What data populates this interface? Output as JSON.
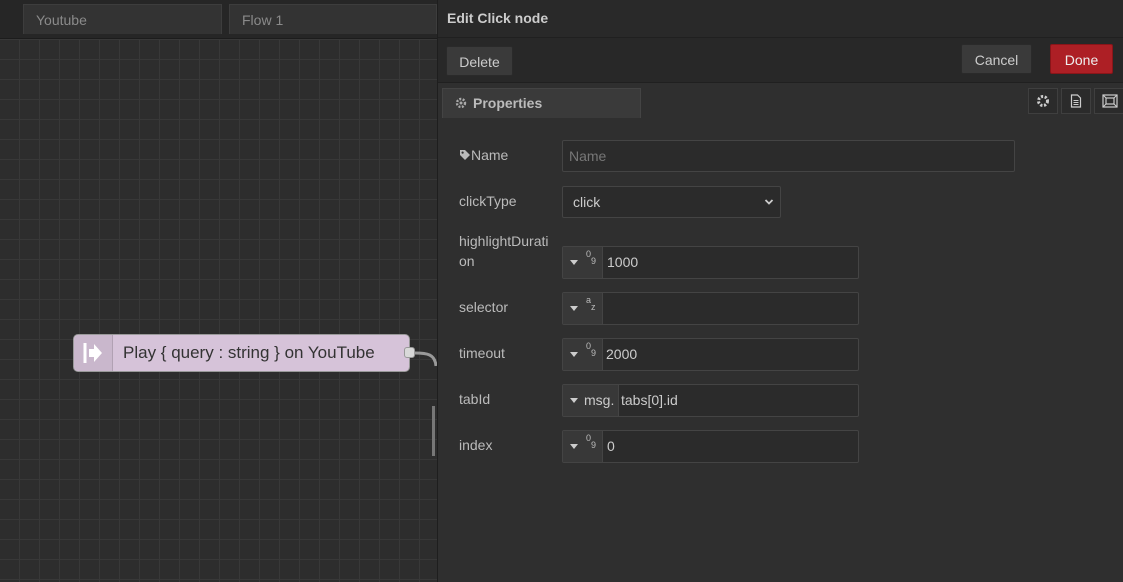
{
  "workspace": {
    "tabs": [
      "Youtube",
      "Flow 1"
    ],
    "node": {
      "label": "Play { query : string } on YouTube",
      "color": "#d6c3d9"
    }
  },
  "tray": {
    "title": "Edit Click node",
    "delete_label": "Delete",
    "cancel_label": "Cancel",
    "done_label": "Done",
    "properties_tab": "Properties",
    "side_icons": [
      "gear-icon",
      "document-icon",
      "frame-icon"
    ]
  },
  "form": {
    "name": {
      "label": "Name",
      "placeholder": "Name",
      "value": ""
    },
    "clickType": {
      "label": "clickType",
      "value": "click"
    },
    "highlightDuration": {
      "label_line1": "highlightDurati",
      "label_line2": "on",
      "type": "num",
      "value": "1000"
    },
    "selector": {
      "label": "selector",
      "type": "str",
      "value": ""
    },
    "timeout": {
      "label": "timeout",
      "type": "num",
      "value": "2000"
    },
    "tabId": {
      "label": "tabId",
      "type_label": "msg.",
      "value": "tabs[0].id"
    },
    "index": {
      "label": "index",
      "type": "num",
      "value": "0"
    }
  },
  "colors": {
    "accent": "#ad1f25",
    "background": "#2f2f2f"
  }
}
